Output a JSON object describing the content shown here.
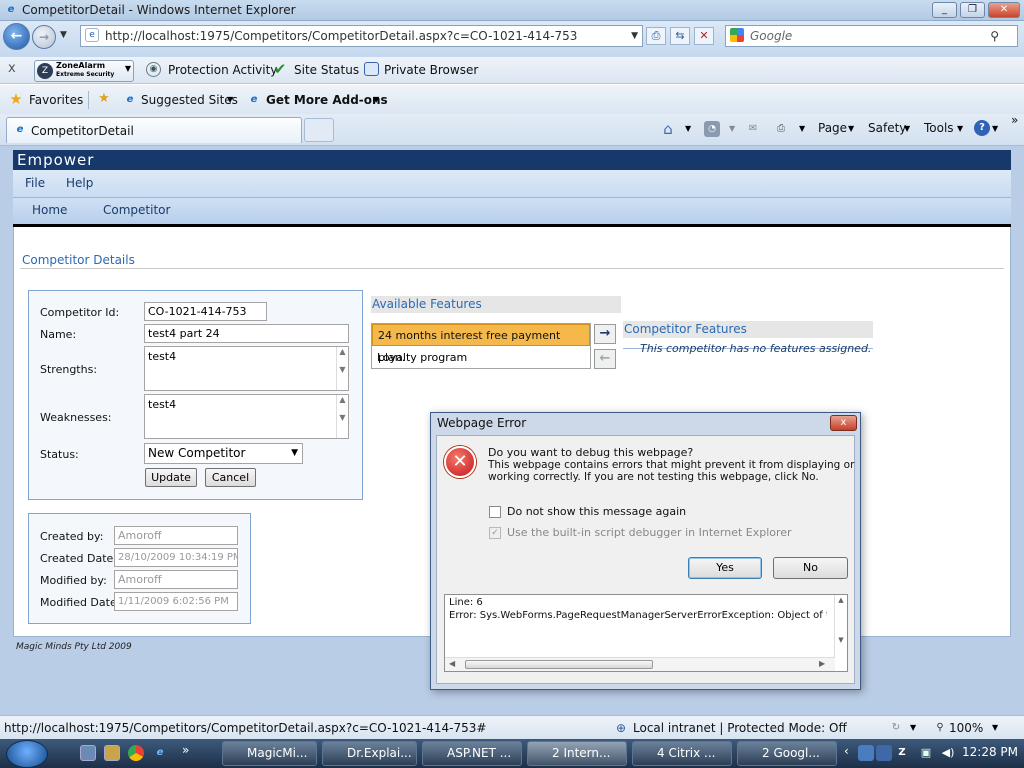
{
  "window": {
    "title": "CompetitorDetail - Windows Internet Explorer"
  },
  "nav": {
    "url": "http://localhost:1975/Competitors/CompetitorDetail.aspx?c=CO-1021-414-753",
    "search_placeholder": "Google"
  },
  "toolbar": {
    "close": "x",
    "zonealarm_line1": "ZoneAlarm",
    "zonealarm_line2": "Extreme Security",
    "protection": "Protection Activity",
    "site_status": "Site Status",
    "private_browser": "Private Browser"
  },
  "favorites": {
    "label": "Favorites",
    "suggested": "Suggested Sites",
    "addons": "Get More Add-ons"
  },
  "tab": {
    "label": "CompetitorDetail"
  },
  "commandbar": {
    "page": "Page",
    "safety": "Safety",
    "tools": "Tools",
    "help": "?",
    "more": "»"
  },
  "app": {
    "brand": "Empower",
    "menu": [
      "File",
      "Help"
    ],
    "tabs": [
      "Home",
      "Competitor"
    ],
    "section_title": "Competitor Details",
    "form": {
      "id_label": "Competitor Id:",
      "id_value": "CO-1021-414-753",
      "name_label": "Name:",
      "name_value": "test4 part 24",
      "strengths_label": "Strengths:",
      "strengths_value": "test4",
      "weaknesses_label": "Weaknesses:",
      "weaknesses_value": "test4",
      "status_label": "Status:",
      "status_value": "New Competitor",
      "update": "Update",
      "cancel": "Cancel"
    },
    "audit": {
      "created_by_label": "Created by:",
      "created_by": "Amoroff",
      "created_date_label": "Created Date:",
      "created_date": "28/10/2009 10:34:19 PM",
      "modified_by_label": "Modified by:",
      "modified_by": "Amoroff",
      "modified_date_label": "Modified Date:",
      "modified_date": "1/11/2009 6:02:56 PM"
    },
    "available_title": "Available Features",
    "available": [
      "24 months interest free payment plan.",
      "Loyalty program"
    ],
    "competitor_features_title": "Competitor Features",
    "no_features": "This competitor has no features assigned.",
    "footer": "Magic Minds Pty Ltd 2009"
  },
  "dialog": {
    "title": "Webpage Error",
    "close": "x",
    "question": "Do you want to debug this webpage?",
    "line1": "This webpage contains errors that might prevent it from displaying or",
    "line2": "working correctly. If you are not testing this webpage, click No.",
    "checkbox1": "Do not show this message again",
    "checkbox2": "Use the built-in script debugger in Internet Explorer",
    "yes": "Yes",
    "no": "No",
    "err_line": "Line: 6",
    "err_text": "Error: Sys.WebForms.PageRequestManagerServerErrorException: Object of t"
  },
  "status": {
    "url": "http://localhost:1975/Competitors/CompetitorDetail.aspx?c=CO-1021-414-753#",
    "zone": "Local intranet | Protected Mode: Off",
    "zoom": "100%"
  },
  "taskbar": {
    "items": [
      "MagicMi...",
      "Dr.Explai...",
      "ASP.NET ...",
      "2 Intern...",
      "4 Citrix ...",
      "2 Googl..."
    ],
    "clock": "12:28 PM"
  }
}
